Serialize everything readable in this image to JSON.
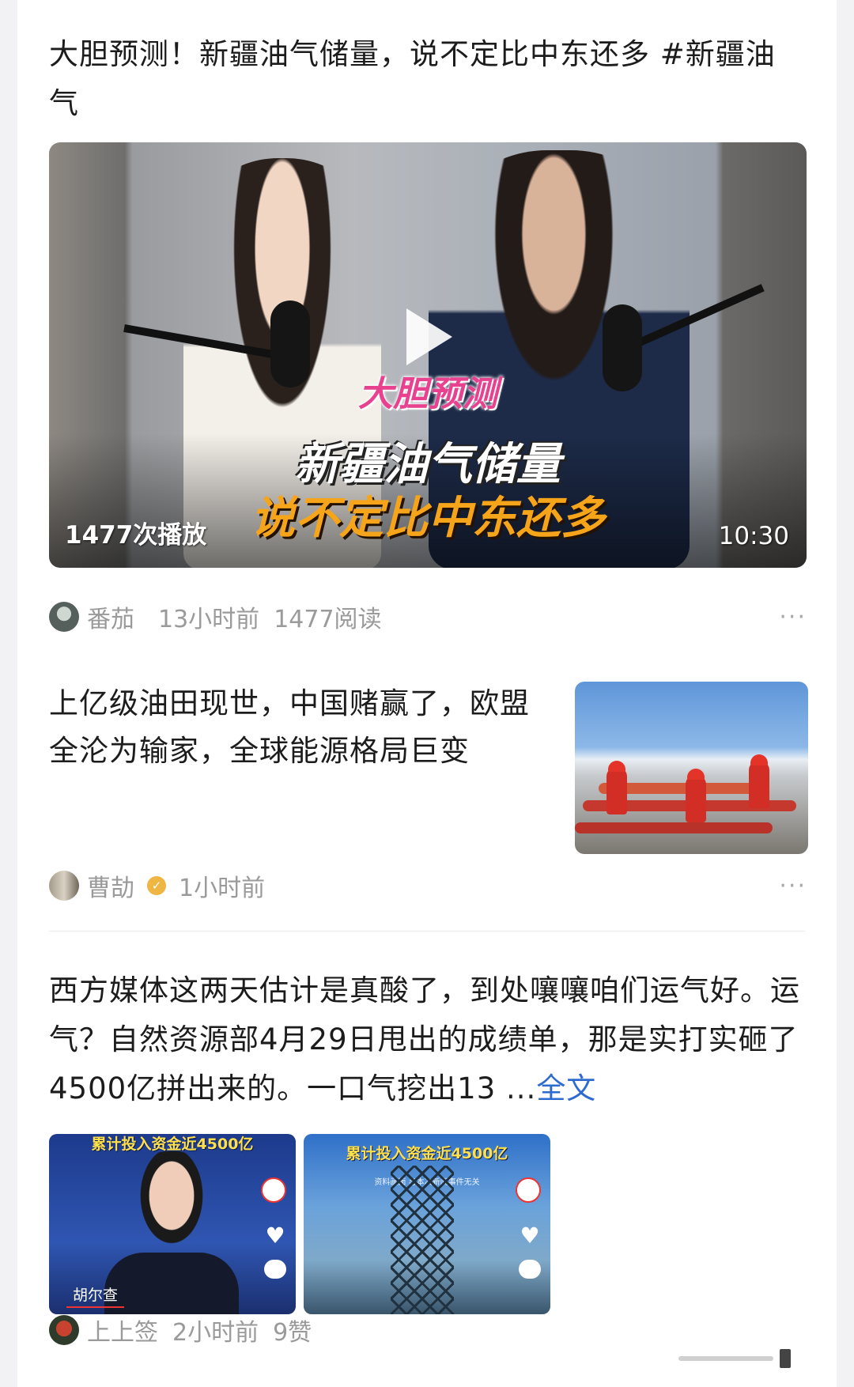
{
  "posts": [
    {
      "title": "大胆预测！新疆油气储量，说不定比中东还多 #新疆油气",
      "video": {
        "caption_top": "大胆预测",
        "caption_main": "新疆油气储量",
        "caption_bottom": "说不定比中东还多",
        "play_count": "1477次播放",
        "duration": "10:30"
      },
      "author": "番茄",
      "time": "13小时前",
      "reads": "1477阅读",
      "more": "···"
    },
    {
      "title": "上亿级油田现世，中国赌赢了，欧盟全沦为输家，全球能源格局巨变",
      "author": "曹劼",
      "time": "1小时前",
      "more": "···"
    },
    {
      "title": "西方媒体这两天估计是真酸了，到处嚷嚷咱们运气好。运气？自然资源部4月29日甩出的成绩单，那是实打实砸了4500亿拼出来的。一口气挖出13",
      "ellipsis": "...",
      "full_text_link": "全文",
      "image1": {
        "headline": "累计投入资金近4500亿",
        "anchor_name": "胡尔查"
      },
      "image2": {
        "headline": "累计投入资金近4500亿",
        "sub": "资料画面 与本次新闻事件无关"
      },
      "author": "上上签",
      "time": "2小时前",
      "likes": "9赞"
    }
  ],
  "colors": {
    "link": "#2e6bcf",
    "meta_text": "#9a9a9a",
    "verified_badge": "#f0b643"
  },
  "icons": [
    "play-icon",
    "more-icon",
    "verified-badge-icon",
    "heart-icon",
    "chat-icon"
  ]
}
